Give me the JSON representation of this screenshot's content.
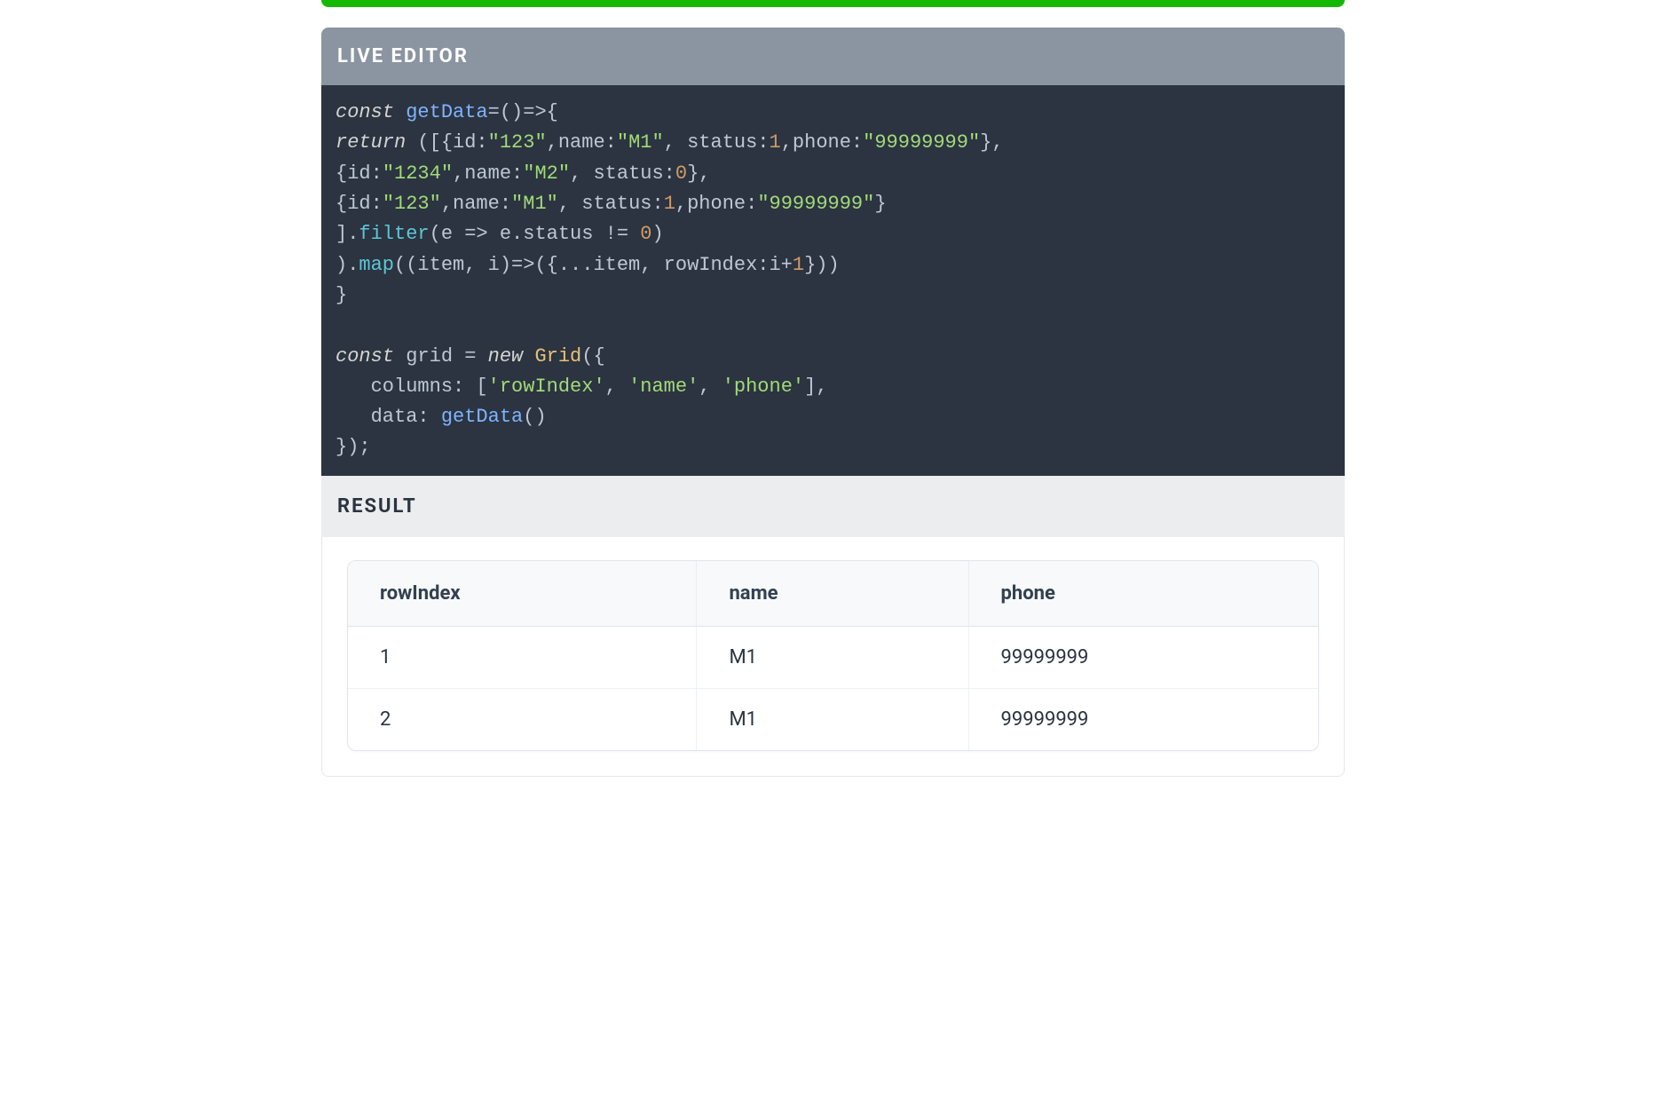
{
  "top_bar": {
    "color": "#14b800"
  },
  "editor": {
    "header": "LIVE EDITOR",
    "code_tokens": [
      [
        [
          "kw",
          "const"
        ],
        [
          "punc",
          " "
        ],
        [
          "fn",
          "getData"
        ],
        [
          "punc",
          "=()=>{ "
        ]
      ],
      [
        [
          "kw",
          "return"
        ],
        [
          "punc",
          " (["
        ],
        [
          "punc",
          "{"
        ],
        [
          "punc",
          "id:"
        ],
        [
          "str",
          "\"123\""
        ],
        [
          "punc",
          ",name:"
        ],
        [
          "str",
          "\"M1\""
        ],
        [
          "punc",
          ", status:"
        ],
        [
          "num",
          "1"
        ],
        [
          "punc",
          ",phone:"
        ],
        [
          "str",
          "\"99999999\""
        ],
        [
          "punc",
          "},"
        ]
      ],
      [
        [
          "punc",
          "{"
        ],
        [
          "punc",
          "id:"
        ],
        [
          "str",
          "\"1234\""
        ],
        [
          "punc",
          ",name:"
        ],
        [
          "str",
          "\"M2\""
        ],
        [
          "punc",
          ", status:"
        ],
        [
          "num",
          "0"
        ],
        [
          "punc",
          "},"
        ]
      ],
      [
        [
          "punc",
          "{"
        ],
        [
          "punc",
          "id:"
        ],
        [
          "str",
          "\"123\""
        ],
        [
          "punc",
          ",name:"
        ],
        [
          "str",
          "\"M1\""
        ],
        [
          "punc",
          ", status:"
        ],
        [
          "num",
          "1"
        ],
        [
          "punc",
          ",phone:"
        ],
        [
          "str",
          "\"99999999\""
        ],
        [
          "punc",
          "}"
        ]
      ],
      [
        [
          "punc",
          "]."
        ],
        [
          "method",
          "filter"
        ],
        [
          "punc",
          "(e => e.status != "
        ],
        [
          "num",
          "0"
        ],
        [
          "punc",
          ")"
        ]
      ],
      [
        [
          "punc",
          ")."
        ],
        [
          "method",
          "map"
        ],
        [
          "punc",
          "((item, i)=>({...item, rowIndex:i+"
        ],
        [
          "num",
          "1"
        ],
        [
          "punc",
          "}))"
        ]
      ],
      [
        [
          "punc",
          "}"
        ]
      ],
      [
        [
          "punc",
          ""
        ]
      ],
      [
        [
          "kw",
          "const"
        ],
        [
          "punc",
          " grid = "
        ],
        [
          "kw",
          "new"
        ],
        [
          "punc",
          " "
        ],
        [
          "cls",
          "Grid"
        ],
        [
          "punc",
          "({"
        ]
      ],
      [
        [
          "punc",
          "   columns: ["
        ],
        [
          "str",
          "'rowIndex'"
        ],
        [
          "punc",
          ", "
        ],
        [
          "str",
          "'name'"
        ],
        [
          "punc",
          ", "
        ],
        [
          "str",
          "'phone'"
        ],
        [
          "punc",
          "],"
        ]
      ],
      [
        [
          "punc",
          "   data: "
        ],
        [
          "fn",
          "getData"
        ],
        [
          "punc",
          "()"
        ]
      ],
      [
        [
          "punc",
          "});"
        ]
      ]
    ]
  },
  "result": {
    "header": "RESULT",
    "columns": [
      "rowIndex",
      "name",
      "phone"
    ],
    "rows": [
      {
        "rowIndex": "1",
        "name": "M1",
        "phone": "99999999"
      },
      {
        "rowIndex": "2",
        "name": "M1",
        "phone": "99999999"
      }
    ]
  }
}
